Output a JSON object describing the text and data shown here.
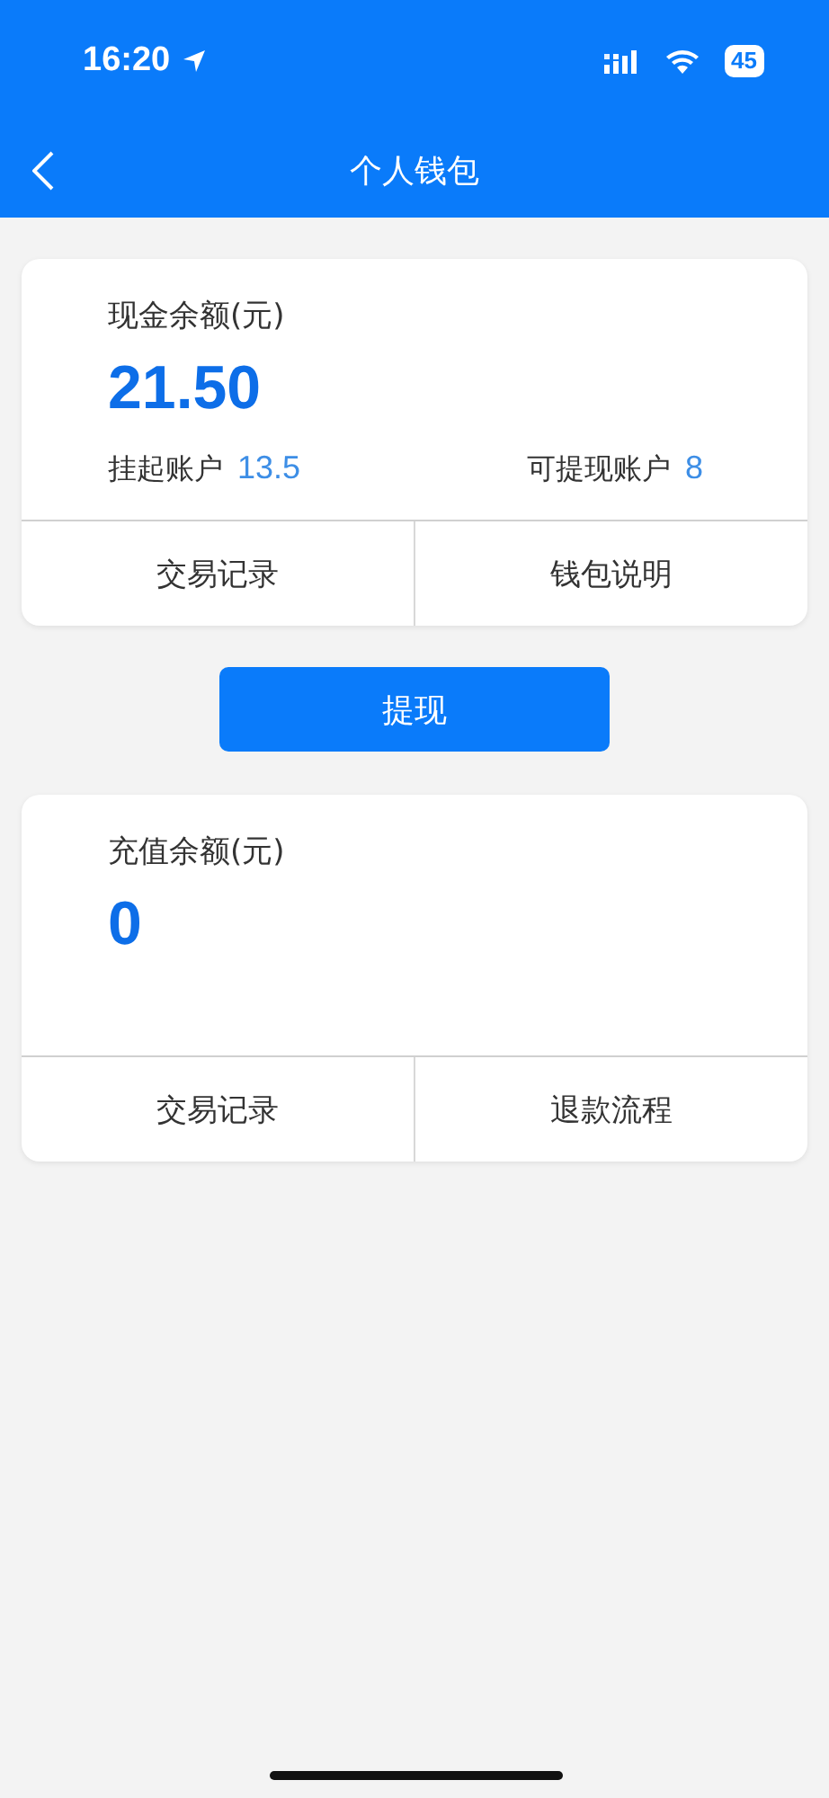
{
  "status_bar": {
    "time": "16:20",
    "battery": "45"
  },
  "nav": {
    "title": "个人钱包"
  },
  "wallets": [
    {
      "label": "现金余额(元)",
      "amount": "21.50",
      "accounts": [
        {
          "label": "挂起账户",
          "value": "13.5"
        },
        {
          "label": "可提现账户",
          "value": "8"
        }
      ],
      "actions": [
        "交易记录",
        "钱包说明"
      ]
    },
    {
      "label": "充值余额(元)",
      "amount": "0",
      "actions": [
        "交易记录",
        "退款流程"
      ]
    }
  ],
  "withdraw_button": "提现"
}
